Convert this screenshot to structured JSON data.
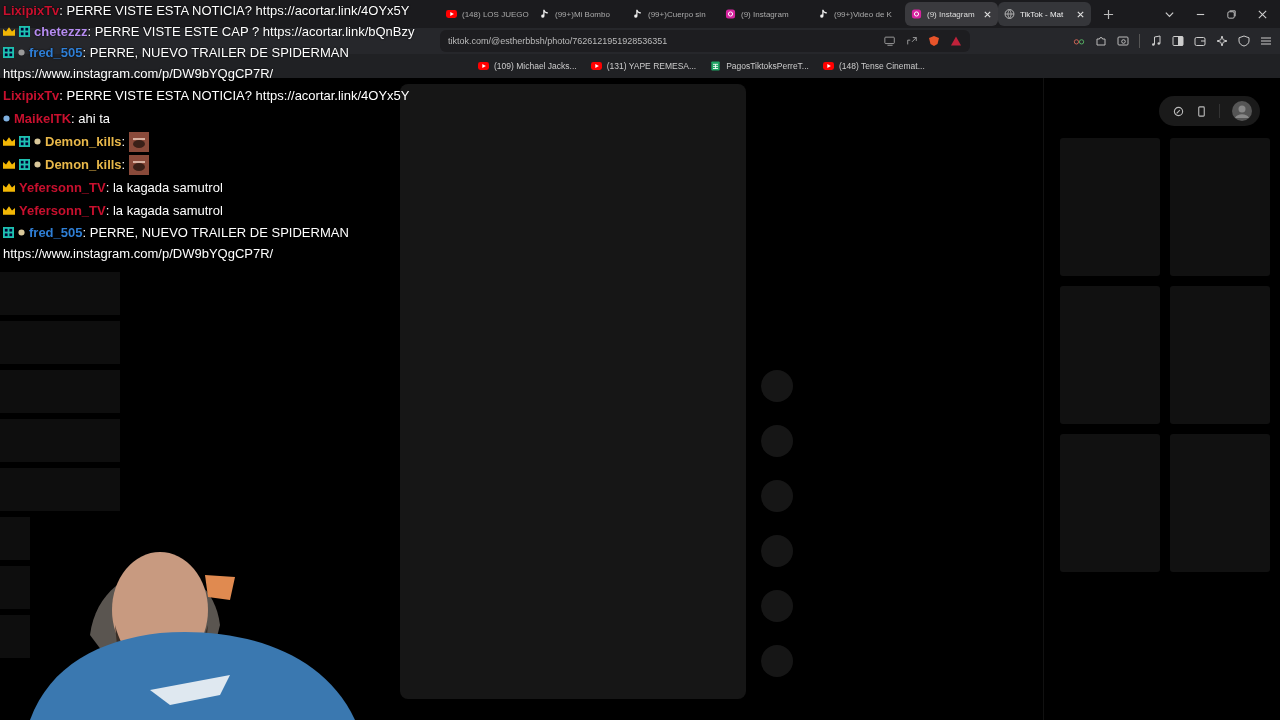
{
  "tabs": [
    {
      "label": "(148) LOS JUEGO",
      "kind": "play",
      "selected": false,
      "hovered": false
    },
    {
      "label": "(99+)Mi Bombo",
      "kind": "note",
      "selected": false,
      "hovered": false
    },
    {
      "label": "(99+)Cuerpo sin",
      "kind": "note",
      "selected": false,
      "hovered": false
    },
    {
      "label": "(9) Instagram",
      "kind": "camera",
      "selected": false,
      "hovered": false
    },
    {
      "label": "(99+)Video de K",
      "kind": "note",
      "selected": false,
      "hovered": false
    },
    {
      "label": "(9) Instagram",
      "kind": "camera",
      "selected": false,
      "hovered": true
    },
    {
      "label": "TikTok - Mat",
      "kind": "globe",
      "selected": true,
      "hovered": false
    }
  ],
  "address": {
    "url": "tiktok.com/@estherbbsh/photo/7626121951928536351"
  },
  "bookmarks": [
    {
      "label": "(109) Michael Jacks...",
      "kind": "play"
    },
    {
      "label": "(131) YAPE REMESA...",
      "kind": "play"
    },
    {
      "label": "PagosTiktoksPerreT...",
      "kind": "sheet"
    },
    {
      "label": "(148) Tense Cinemat...",
      "kind": "play"
    }
  ],
  "overlay_chat": [
    {
      "user": "LixipixTv",
      "color": "#c8102e",
      "has_crown": false,
      "has_sub": false,
      "has_dot": false,
      "text": ": PERRE VISTE ESTA NOTICIA? https://acortar.link/4OYx5Y"
    },
    {
      "user": "chetezzz",
      "color": "#b68cf0",
      "has_crown": true,
      "has_sub": true,
      "has_dot": false,
      "text": ": PERRE VISTE ESTE CAP ? https://acortar.link/bQnBzy"
    },
    {
      "user": "fred_505",
      "color": "#2f7fd6",
      "has_crown": false,
      "has_sub": true,
      "has_dot": true,
      "text": ": PERRE, NUEVO TRAILER DE SPIDERMAN",
      "link": "https://www.instagram.com/p/DW9bYQgCP7R/"
    }
  ],
  "chat": [
    {
      "user": "LixipixTv",
      "color": "#c8102e",
      "has_crown": false,
      "has_sub": false,
      "has_dot": false,
      "emote": false,
      "text": ": PERRE VISTE ESTA NOTICIA? https://acortar.link/4OYx5Y"
    },
    {
      "user": "MaikelTK",
      "color": "#c8102e",
      "has_crown": false,
      "has_sub": false,
      "has_dot": true,
      "emote": false,
      "text": ": ahi ta"
    },
    {
      "user": "Demon_kills",
      "color": "#e8b84a",
      "has_crown": true,
      "has_sub": true,
      "has_dot": true,
      "emote": true,
      "text": ":"
    },
    {
      "user": "Demon_kills",
      "color": "#e8b84a",
      "has_crown": true,
      "has_sub": true,
      "has_dot": true,
      "emote": true,
      "text": ":"
    },
    {
      "user": "Yefersonn_TV",
      "color": "#c8102e",
      "has_crown": true,
      "has_sub": false,
      "has_dot": false,
      "emote": false,
      "text": ": la kagada samutrol"
    },
    {
      "user": "Yefersonn_TV",
      "color": "#c8102e",
      "has_crown": true,
      "has_sub": false,
      "has_dot": false,
      "emote": false,
      "text": ": la kagada samutrol"
    },
    {
      "user": "fred_505",
      "color": "#2f7fd6",
      "has_crown": false,
      "has_sub": true,
      "has_dot": true,
      "emote": false,
      "text": ": PERRE, NUEVO TRAILER DE SPIDERMAN",
      "link": "https://www.instagram.com/p/DW9bYQgCP7R/"
    }
  ]
}
